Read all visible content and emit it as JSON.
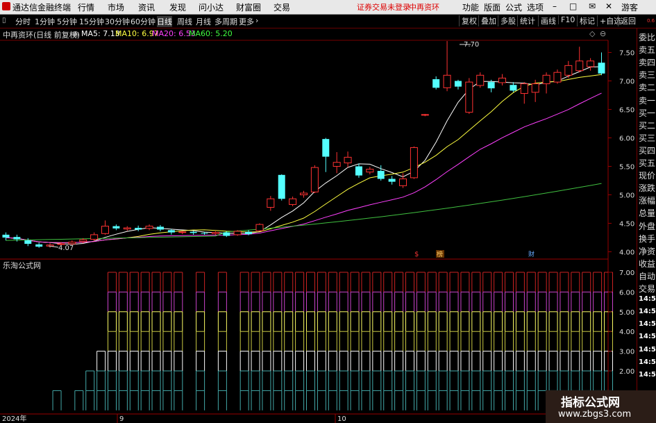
{
  "menubar": {
    "app_title": "通达信金融终端",
    "menus": [
      "行情",
      "市场",
      "资讯",
      "发现",
      "问小达",
      "财富圈",
      "交易"
    ],
    "login_notice": "证券交易未登录",
    "stock_name": "中再资环",
    "right_menus": [
      "功能",
      "版面",
      "公式",
      "选项"
    ],
    "guest": "游客",
    "window_controls": [
      "–",
      "□",
      "✕"
    ]
  },
  "toolbar": {
    "periods": [
      "分时",
      "1分钟",
      "5分钟",
      "15分钟",
      "30分钟",
      "60分钟",
      "日线",
      "周线",
      "月线",
      "多周期",
      "更多"
    ],
    "active_period": "日线",
    "buttons": [
      "复权",
      "叠加",
      "多股",
      "统计",
      "画线",
      "F10",
      "标记",
      "+自选",
      "返回"
    ]
  },
  "price_header": {
    "title": "中再资环(日线 前复权)",
    "ma_values": [
      {
        "label": "MA5: 7.13",
        "color": "#ffffff"
      },
      {
        "label": "MA10: 6.97",
        "color": "#ffff40"
      },
      {
        "label": "MA20: 6.53",
        "color": "#ff40ff"
      },
      {
        "label": "MA60: 5.20",
        "color": "#40ff40"
      }
    ]
  },
  "main_axis": {
    "ticks": [
      "7.50",
      "7.00",
      "6.50",
      "6.00",
      "5.50",
      "5.00",
      "4.50",
      "4.00"
    ],
    "high_label": "7.70",
    "low_label": "4.07",
    "markers": [
      "$",
      "榜",
      "财"
    ]
  },
  "indicator": {
    "title": "乐淘公式网",
    "ticks": [
      "7.00",
      "6.00",
      "5.00",
      "4.00",
      "3.00",
      "2.00"
    ]
  },
  "date_axis": {
    "labels": [
      "2024年",
      "9",
      "10"
    ]
  },
  "sidebar": {
    "items": [
      "委比",
      "卖五",
      "卖四",
      "卖三",
      "卖二",
      "卖一",
      "买一",
      "买二",
      "买三",
      "买四",
      "买五",
      "现价",
      "涨跌",
      "涨幅",
      "总量",
      "外盘",
      "换手",
      "净资",
      "收益",
      "自动",
      "交易",
      "14:56",
      "14:56",
      "14:56",
      "14:56",
      "14:56",
      "14:56",
      "14:56"
    ],
    "top_small": "0.6"
  },
  "chart_data": {
    "type": "candlestick",
    "title": "中再资环(日线 前复权)",
    "ylim": [
      3.95,
      7.75
    ],
    "candles": [
      {
        "o": 4.3,
        "c": 4.25,
        "h": 4.34,
        "l": 4.2
      },
      {
        "o": 4.26,
        "c": 4.22,
        "h": 4.3,
        "l": 4.18
      },
      {
        "o": 4.2,
        "c": 4.14,
        "h": 4.24,
        "l": 4.1
      },
      {
        "o": 4.13,
        "c": 4.09,
        "h": 4.16,
        "l": 4.07
      },
      {
        "o": 4.1,
        "c": 4.12,
        "h": 4.15,
        "l": 4.07
      },
      {
        "o": 4.13,
        "c": 4.14,
        "h": 4.17,
        "l": 4.1
      },
      {
        "o": 4.14,
        "c": 4.17,
        "h": 4.2,
        "l": 4.12
      },
      {
        "o": 4.18,
        "c": 4.21,
        "h": 4.24,
        "l": 4.15
      },
      {
        "o": 4.22,
        "c": 4.3,
        "h": 4.34,
        "l": 4.19
      },
      {
        "o": 4.32,
        "c": 4.45,
        "h": 4.55,
        "l": 4.3
      },
      {
        "o": 4.45,
        "c": 4.41,
        "h": 4.48,
        "l": 4.38
      },
      {
        "o": 4.4,
        "c": 4.42,
        "h": 4.45,
        "l": 4.37
      },
      {
        "o": 4.42,
        "c": 4.39,
        "h": 4.46,
        "l": 4.36
      },
      {
        "o": 4.41,
        "c": 4.45,
        "h": 4.48,
        "l": 4.38
      },
      {
        "o": 4.44,
        "c": 4.39,
        "h": 4.47,
        "l": 4.36
      },
      {
        "o": 4.38,
        "c": 4.34,
        "h": 4.4,
        "l": 4.3
      },
      {
        "o": 4.34,
        "c": 4.35,
        "h": 4.37,
        "l": 4.31
      },
      {
        "o": 4.35,
        "c": 4.33,
        "h": 4.37,
        "l": 4.3
      },
      {
        "o": 4.33,
        "c": 4.32,
        "h": 4.35,
        "l": 4.3
      },
      {
        "o": 4.32,
        "c": 4.34,
        "h": 4.36,
        "l": 4.3
      },
      {
        "o": 4.34,
        "c": 4.28,
        "h": 4.36,
        "l": 4.26
      },
      {
        "o": 4.3,
        "c": 4.36,
        "h": 4.38,
        "l": 4.28
      },
      {
        "o": 4.35,
        "c": 4.31,
        "h": 4.38,
        "l": 4.29
      },
      {
        "o": 4.37,
        "c": 4.48,
        "h": 4.5,
        "l": 4.36
      },
      {
        "o": 4.78,
        "c": 4.93,
        "h": 4.98,
        "l": 4.72
      },
      {
        "o": 5.35,
        "c": 4.93,
        "h": 5.36,
        "l": 4.9
      },
      {
        "o": 4.83,
        "c": 4.93,
        "h": 4.97,
        "l": 4.8
      },
      {
        "o": 5.0,
        "c": 5.03,
        "h": 5.07,
        "l": 4.95
      },
      {
        "o": 5.05,
        "c": 5.48,
        "h": 5.52,
        "l": 5.03
      },
      {
        "o": 5.98,
        "c": 5.67,
        "h": 6.0,
        "l": 5.4
      },
      {
        "o": 5.5,
        "c": 5.57,
        "h": 5.75,
        "l": 5.38
      },
      {
        "o": 5.56,
        "c": 5.66,
        "h": 5.76,
        "l": 5.48
      },
      {
        "o": 5.5,
        "c": 5.34,
        "h": 5.55,
        "l": 5.3
      },
      {
        "o": 5.4,
        "c": 5.45,
        "h": 5.49,
        "l": 5.36
      },
      {
        "o": 5.42,
        "c": 5.28,
        "h": 5.52,
        "l": 5.25
      },
      {
        "o": 5.28,
        "c": 5.23,
        "h": 5.33,
        "l": 5.18
      },
      {
        "o": 5.16,
        "c": 5.28,
        "h": 5.38,
        "l": 5.12
      },
      {
        "o": 5.3,
        "c": 5.83,
        "h": 5.85,
        "l": 5.28
      },
      {
        "o": 6.4,
        "c": 6.41,
        "h": 6.42,
        "l": 6.38
      },
      {
        "o": 7.03,
        "c": 6.88,
        "h": 7.08,
        "l": 6.85
      },
      {
        "o": 6.88,
        "c": 7.1,
        "h": 7.7,
        "l": 6.82
      },
      {
        "o": 7.0,
        "c": 6.9,
        "h": 7.02,
        "l": 6.85
      },
      {
        "o": 6.45,
        "c": 6.98,
        "h": 7.05,
        "l": 6.42
      },
      {
        "o": 6.92,
        "c": 7.1,
        "h": 7.15,
        "l": 6.88
      },
      {
        "o": 6.98,
        "c": 6.87,
        "h": 7.02,
        "l": 6.8
      },
      {
        "o": 6.97,
        "c": 7.05,
        "h": 7.12,
        "l": 6.92
      },
      {
        "o": 6.93,
        "c": 6.83,
        "h": 6.98,
        "l": 6.8
      },
      {
        "o": 6.78,
        "c": 6.95,
        "h": 6.98,
        "l": 6.6
      },
      {
        "o": 6.8,
        "c": 6.95,
        "h": 7.02,
        "l": 6.63
      },
      {
        "o": 6.95,
        "c": 7.1,
        "h": 7.15,
        "l": 6.78
      },
      {
        "o": 6.98,
        "c": 7.15,
        "h": 7.2,
        "l": 6.95
      },
      {
        "o": 7.1,
        "c": 7.27,
        "h": 7.35,
        "l": 7.05
      },
      {
        "o": 7.18,
        "c": 7.35,
        "h": 7.6,
        "l": 7.15
      },
      {
        "o": 7.25,
        "c": 7.35,
        "h": 7.4,
        "l": 7.18
      },
      {
        "o": 7.32,
        "c": 7.13,
        "h": 7.5,
        "l": 7.1
      }
    ]
  }
}
